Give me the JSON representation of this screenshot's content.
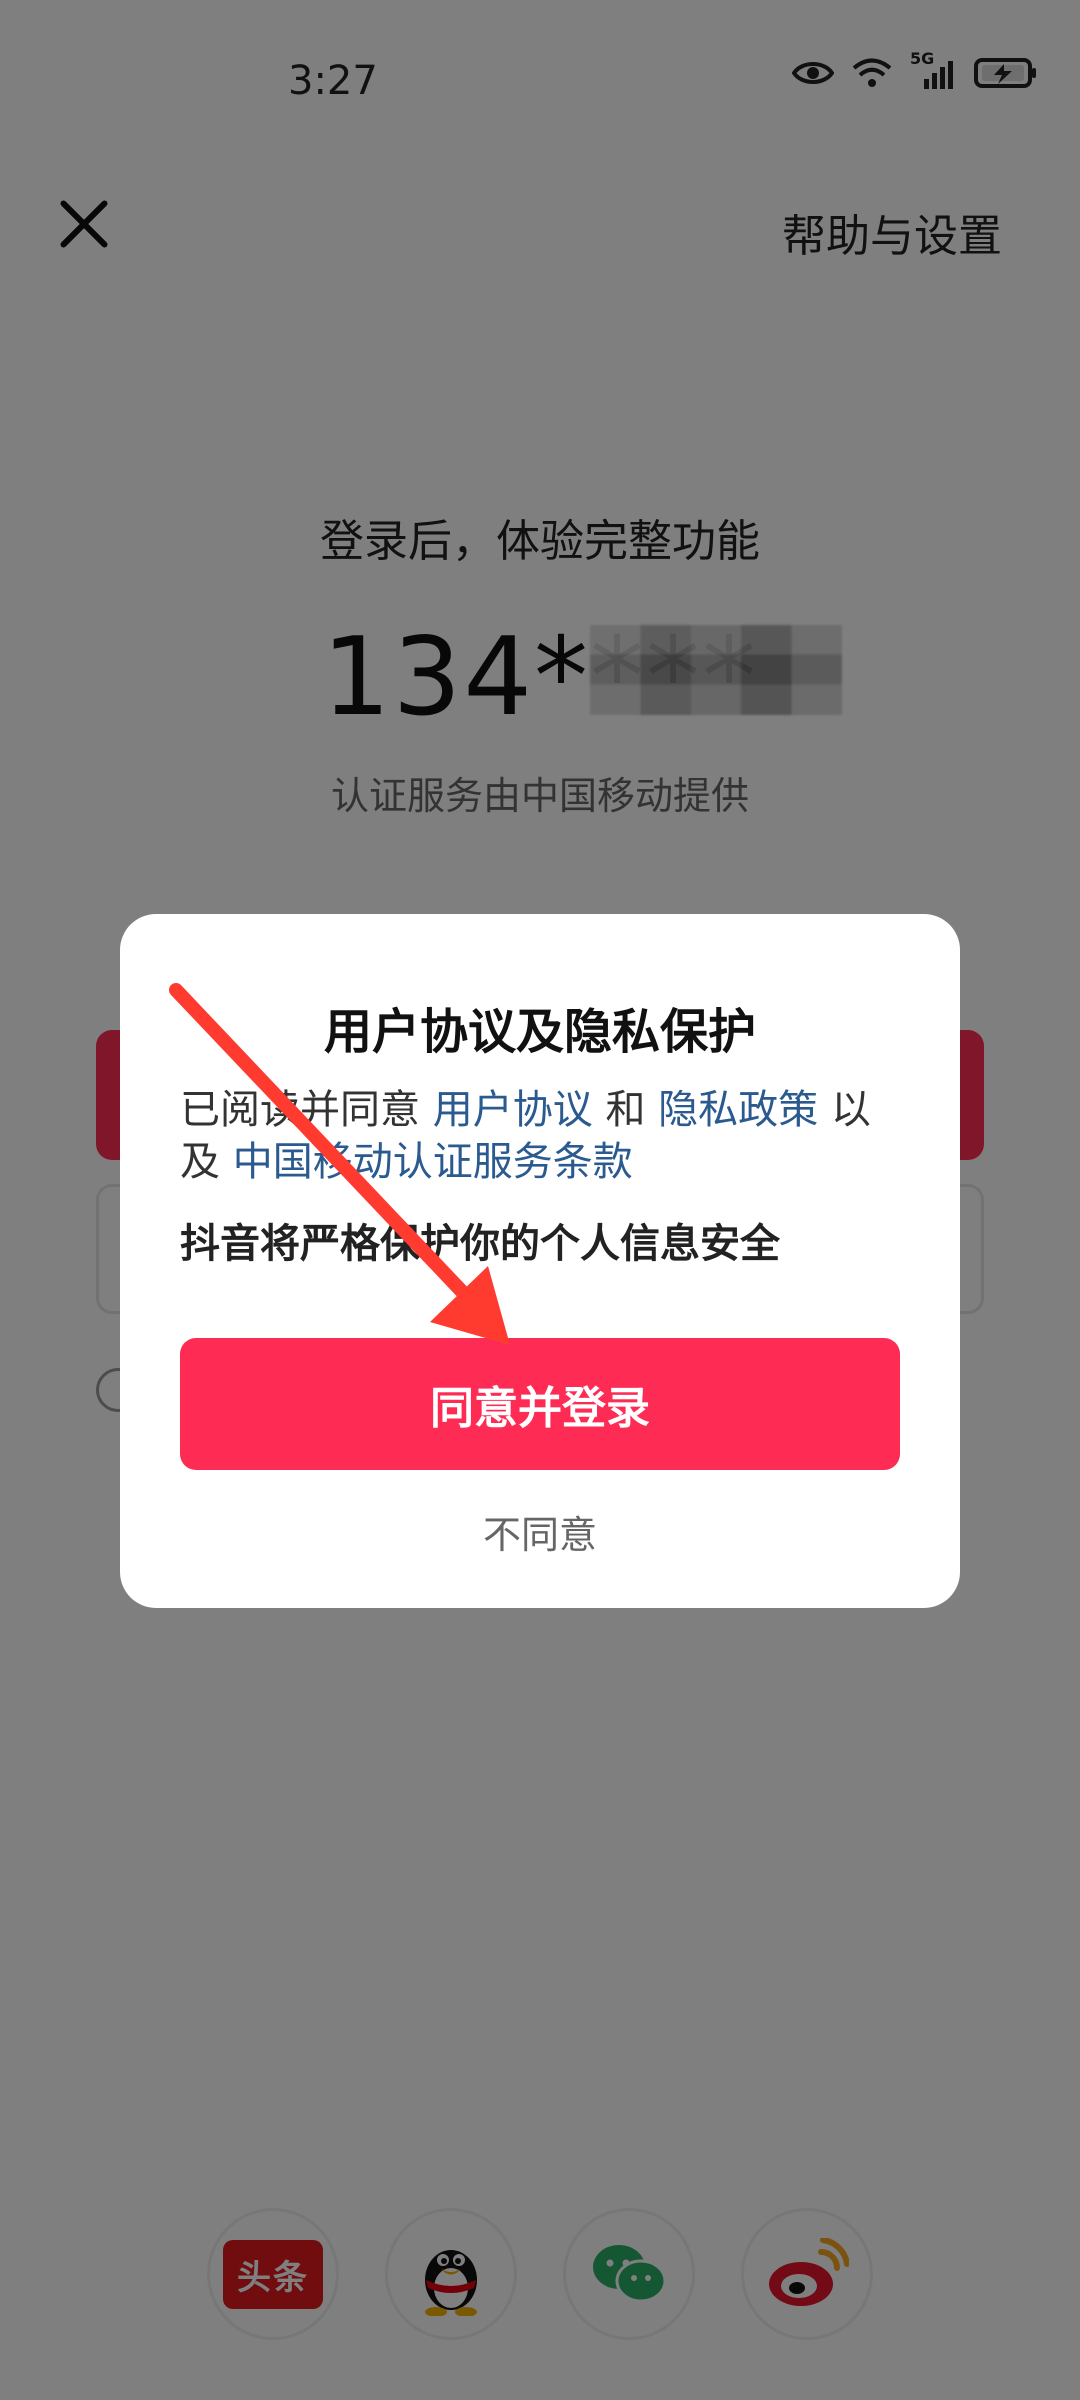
{
  "status_bar": {
    "time": "3:27",
    "network": "5G"
  },
  "header": {
    "help": "帮助与设置"
  },
  "main": {
    "subtitle": "登录后，体验完整功能",
    "phone": "134****",
    "auth_note": "认证服务由中国移动提供"
  },
  "dialog": {
    "title": "用户协议及隐私保护",
    "text_prefix": "已阅读并同意",
    "link_user": "用户协议",
    "and": "和",
    "link_privacy": "隐私政策",
    "mid": "以",
    "line2_prefix": "及",
    "link_cmcc": "中国移动认证服务条款",
    "note": "抖音将严格保护你的个人信息安全",
    "agree": "同意并登录",
    "disagree": "不同意"
  },
  "social": {
    "toutiao": "头条"
  },
  "colors": {
    "accent": "#fe2c55",
    "link": "#2a5a8f",
    "arrow": "#ff3b30"
  }
}
